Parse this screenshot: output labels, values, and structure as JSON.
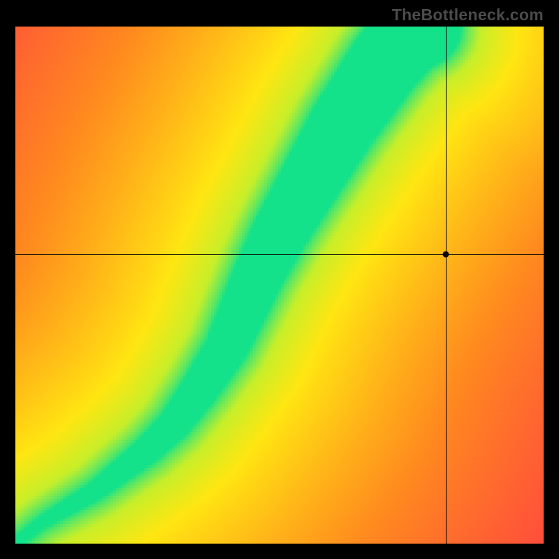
{
  "brand": {
    "watermark": "TheBottleneck.com"
  },
  "colors": {
    "black": "#000000",
    "red": "#ff2b4d",
    "orange": "#ff8a1f",
    "yellow": "#ffe612",
    "yellowgreen": "#c7ef2a",
    "green": "#14e28a"
  },
  "crosshair": {
    "x_frac": 0.815,
    "y_frac": 0.44
  },
  "chart_data": {
    "type": "heatmap",
    "title": "",
    "xlabel": "",
    "ylabel": "",
    "xlim": [
      0,
      1
    ],
    "ylim": [
      0,
      1
    ],
    "grid": false,
    "series": [
      {
        "name": "optimal-curve",
        "x": [
          0.0,
          0.05,
          0.1,
          0.15,
          0.2,
          0.25,
          0.3,
          0.35,
          0.4,
          0.43,
          0.46,
          0.5,
          0.54,
          0.58,
          0.62,
          0.66,
          0.7,
          0.74,
          0.77
        ],
        "y": [
          0.0,
          0.04,
          0.07,
          0.1,
          0.14,
          0.18,
          0.23,
          0.3,
          0.38,
          0.45,
          0.52,
          0.6,
          0.67,
          0.74,
          0.81,
          0.87,
          0.93,
          0.98,
          1.0
        ],
        "width": [
          0.01,
          0.012,
          0.015,
          0.018,
          0.022,
          0.026,
          0.03,
          0.035,
          0.04,
          0.044,
          0.047,
          0.052,
          0.056,
          0.06,
          0.064,
          0.067,
          0.07,
          0.073,
          0.075
        ]
      }
    ],
    "marker": {
      "x": 0.815,
      "y": 0.56,
      "value_color": "orange"
    },
    "color_scale_note": "green = no bottleneck along curve, fading through yellow/orange to red away from it",
    "max_distance": 0.9
  }
}
